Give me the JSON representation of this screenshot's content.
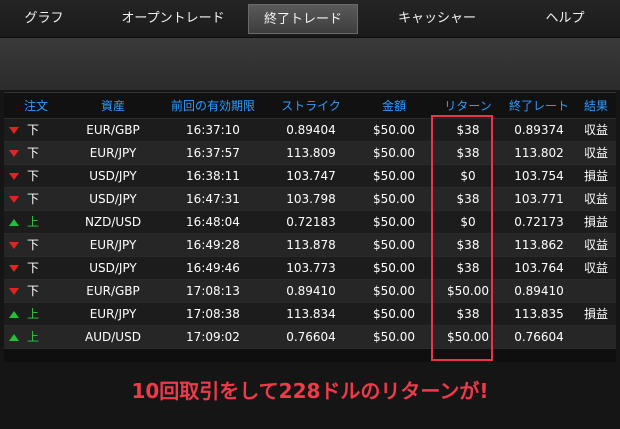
{
  "tabs": [
    {
      "label": "グラフ",
      "active": false
    },
    {
      "label": "オープントレード",
      "active": false
    },
    {
      "label": "終了トレード",
      "active": true
    },
    {
      "label": "キャッシャー",
      "active": false
    },
    {
      "label": "ヘルプ",
      "active": false
    }
  ],
  "table": {
    "headers": [
      "注文",
      "資産",
      "前回の有効期限",
      "ストライク",
      "金額",
      "リターン",
      "終了レート",
      "結果"
    ],
    "rows": [
      {
        "direction": "down",
        "order": "下",
        "asset": "EUR/GBP",
        "expiry": "16:37:10",
        "strike": "0.89404",
        "amount": "$50.00",
        "return": "$38",
        "close_rate": "0.89374",
        "result": "収益"
      },
      {
        "direction": "down",
        "order": "下",
        "asset": "EUR/JPY",
        "expiry": "16:37:57",
        "strike": "113.809",
        "amount": "$50.00",
        "return": "$38",
        "close_rate": "113.802",
        "result": "収益"
      },
      {
        "direction": "down",
        "order": "下",
        "asset": "USD/JPY",
        "expiry": "16:38:11",
        "strike": "103.747",
        "amount": "$50.00",
        "return": "$0",
        "close_rate": "103.754",
        "result": "損益"
      },
      {
        "direction": "down",
        "order": "下",
        "asset": "USD/JPY",
        "expiry": "16:47:31",
        "strike": "103.798",
        "amount": "$50.00",
        "return": "$38",
        "close_rate": "103.771",
        "result": "収益"
      },
      {
        "direction": "up",
        "order": "上",
        "asset": "NZD/USD",
        "expiry": "16:48:04",
        "strike": "0.72183",
        "amount": "$50.00",
        "return": "$0",
        "close_rate": "0.72173",
        "result": "損益"
      },
      {
        "direction": "down",
        "order": "下",
        "asset": "EUR/JPY",
        "expiry": "16:49:28",
        "strike": "113.878",
        "amount": "$50.00",
        "return": "$38",
        "close_rate": "113.862",
        "result": "収益"
      },
      {
        "direction": "down",
        "order": "下",
        "asset": "USD/JPY",
        "expiry": "16:49:46",
        "strike": "103.773",
        "amount": "$50.00",
        "return": "$38",
        "close_rate": "103.764",
        "result": "収益"
      },
      {
        "direction": "down",
        "order": "下",
        "asset": "EUR/GBP",
        "expiry": "17:08:13",
        "strike": "0.89410",
        "amount": "$50.00",
        "return": "$50.00",
        "close_rate": "0.89410",
        "result": ""
      },
      {
        "direction": "up",
        "order": "上",
        "asset": "EUR/JPY",
        "expiry": "17:08:38",
        "strike": "113.834",
        "amount": "$50.00",
        "return": "$38",
        "close_rate": "113.835",
        "result": "損益"
      },
      {
        "direction": "up",
        "order": "上",
        "asset": "AUD/USD",
        "expiry": "17:09:02",
        "strike": "0.76604",
        "amount": "$50.00",
        "return": "$50.00",
        "close_rate": "0.76604",
        "result": ""
      }
    ]
  },
  "caption": "10回取引をして228ドルのリターンが!",
  "colors": {
    "header_text": "#2e9bff",
    "up_arrow": "#22c03a",
    "down_arrow": "#e02424",
    "highlight_box": "#e8354a",
    "caption": "#f03a4a"
  }
}
